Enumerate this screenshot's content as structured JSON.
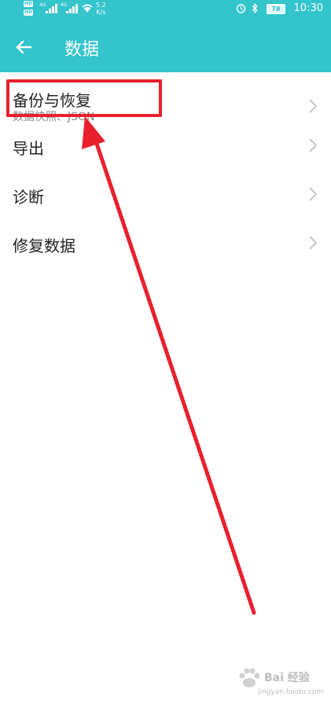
{
  "status_bar": {
    "network_1": "4G",
    "network_2": "4G",
    "hd_1": "HD",
    "hd_2": "HD",
    "speed_value": "5.2",
    "speed_unit": "K/s",
    "battery": "78",
    "time": "10:30"
  },
  "header": {
    "title": "数据",
    "back_icon": "arrow-left-icon",
    "background_color": "#33c4cc"
  },
  "list": {
    "items": [
      {
        "label": "备份与恢复",
        "subtitle": "数据快照、JSON",
        "chevron": "chevron-right-icon"
      },
      {
        "label": "导出",
        "chevron": "chevron-right-icon"
      },
      {
        "label": "诊断",
        "chevron": "chevron-right-icon"
      },
      {
        "label": "修复数据",
        "chevron": "chevron-right-icon"
      }
    ]
  },
  "annotation": {
    "highlight_color": "#e8202e"
  },
  "watermark": {
    "text": "Bai 经验",
    "url": "jingyan.baidu.com"
  }
}
